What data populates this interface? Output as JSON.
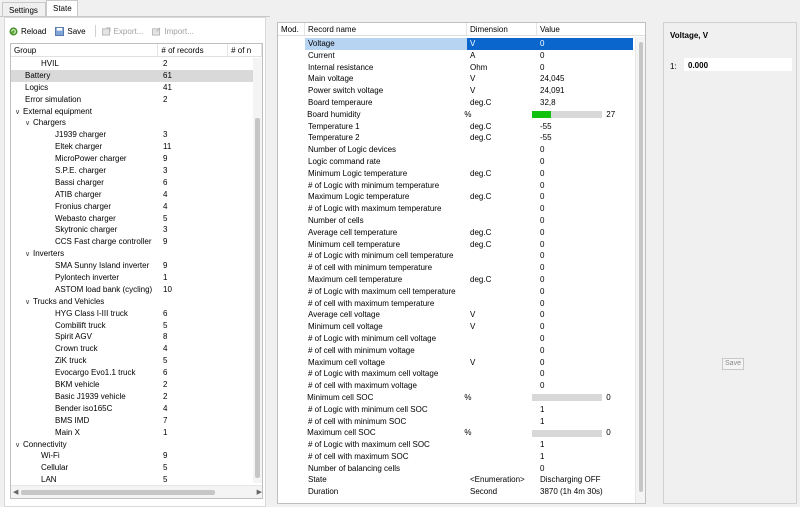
{
  "tabs": [
    {
      "label": "Settings",
      "active": false
    },
    {
      "label": "State",
      "active": true
    }
  ],
  "toolbar": {
    "reload": "Reload",
    "save": "Save",
    "export": "Export...",
    "import": "Import..."
  },
  "tree": {
    "columns": [
      "Group",
      "# of records",
      "# of n"
    ],
    "rows": [
      {
        "name": "HVIL",
        "count": "2",
        "level": 2,
        "arrow": ""
      },
      {
        "name": "Battery",
        "count": "61",
        "level": 1,
        "arrow": "",
        "selected": true
      },
      {
        "name": "Logics",
        "count": "41",
        "level": 1,
        "arrow": ""
      },
      {
        "name": "Error simulation",
        "count": "2",
        "level": 1,
        "arrow": ""
      },
      {
        "name": "External equipment",
        "count": "",
        "level": 0,
        "arrow": "v"
      },
      {
        "name": "Chargers",
        "count": "",
        "level": 1,
        "arrow": "v"
      },
      {
        "name": "J1939 charger",
        "count": "3",
        "level": 3,
        "arrow": ""
      },
      {
        "name": "Eltek charger",
        "count": "11",
        "level": 3,
        "arrow": ""
      },
      {
        "name": "MicroPower charger",
        "count": "9",
        "level": 3,
        "arrow": ""
      },
      {
        "name": "S.P.E. charger",
        "count": "3",
        "level": 3,
        "arrow": ""
      },
      {
        "name": "Bassi charger",
        "count": "6",
        "level": 3,
        "arrow": ""
      },
      {
        "name": "ATIB charger",
        "count": "4",
        "level": 3,
        "arrow": ""
      },
      {
        "name": "Fronius charger",
        "count": "4",
        "level": 3,
        "arrow": ""
      },
      {
        "name": "Webasto charger",
        "count": "5",
        "level": 3,
        "arrow": ""
      },
      {
        "name": "Skytronic charger",
        "count": "3",
        "level": 3,
        "arrow": ""
      },
      {
        "name": "CCS Fast charge controller",
        "count": "9",
        "level": 3,
        "arrow": ""
      },
      {
        "name": "Inverters",
        "count": "",
        "level": 1,
        "arrow": "v"
      },
      {
        "name": "SMA Sunny Island inverter",
        "count": "9",
        "level": 3,
        "arrow": ""
      },
      {
        "name": "Pylontech inverter",
        "count": "1",
        "level": 3,
        "arrow": ""
      },
      {
        "name": "ASTOM load bank (cycling)",
        "count": "10",
        "level": 3,
        "arrow": ""
      },
      {
        "name": "Trucks and Vehicles",
        "count": "",
        "level": 1,
        "arrow": "v"
      },
      {
        "name": "HYG Class I-III truck",
        "count": "6",
        "level": 3,
        "arrow": ""
      },
      {
        "name": "Combilift truck",
        "count": "5",
        "level": 3,
        "arrow": ""
      },
      {
        "name": "Spirit AGV",
        "count": "8",
        "level": 3,
        "arrow": ""
      },
      {
        "name": "Crown truck",
        "count": "4",
        "level": 3,
        "arrow": ""
      },
      {
        "name": "ZiK truck",
        "count": "5",
        "level": 3,
        "arrow": ""
      },
      {
        "name": "Evocargo Evo1.1 truck",
        "count": "6",
        "level": 3,
        "arrow": ""
      },
      {
        "name": "BKM vehicle",
        "count": "2",
        "level": 3,
        "arrow": ""
      },
      {
        "name": "Basic J1939 vehicle",
        "count": "2",
        "level": 3,
        "arrow": ""
      },
      {
        "name": "Bender iso165C",
        "count": "4",
        "level": 3,
        "arrow": ""
      },
      {
        "name": "BMS IMD",
        "count": "7",
        "level": 3,
        "arrow": ""
      },
      {
        "name": "Main X",
        "count": "1",
        "level": 3,
        "arrow": ""
      },
      {
        "name": "Connectivity",
        "count": "",
        "level": 0,
        "arrow": "v"
      },
      {
        "name": "Wi-Fi",
        "count": "9",
        "level": 2,
        "arrow": ""
      },
      {
        "name": "Cellular",
        "count": "5",
        "level": 2,
        "arrow": ""
      },
      {
        "name": "LAN",
        "count": "5",
        "level": 2,
        "arrow": ""
      }
    ]
  },
  "records": {
    "columns": [
      "Mod.",
      "Record name",
      "Dimension",
      "Value"
    ],
    "rows": [
      {
        "name": "Voltage",
        "dim": "V",
        "val": "0",
        "selected": true
      },
      {
        "name": "Current",
        "dim": "A",
        "val": "0"
      },
      {
        "name": "Internal resistance",
        "dim": "Ohm",
        "val": "0"
      },
      {
        "name": "Main voltage",
        "dim": "V",
        "val": "24,045"
      },
      {
        "name": "Power switch voltage",
        "dim": "V",
        "val": "24,091"
      },
      {
        "name": "Board temperaure",
        "dim": "deg.C",
        "val": "32,8"
      },
      {
        "name": "Board humidity",
        "dim": "%",
        "val": "27",
        "bar": 0.27
      },
      {
        "name": "Temperature 1",
        "dim": "deg.C",
        "val": "-55"
      },
      {
        "name": "Temperature 2",
        "dim": "deg.C",
        "val": "-55"
      },
      {
        "name": "Number of Logic devices",
        "dim": "",
        "val": "0"
      },
      {
        "name": "Logic command rate",
        "dim": "",
        "val": "0"
      },
      {
        "name": "Minimum Logic temperature",
        "dim": "deg.C",
        "val": "0"
      },
      {
        "name": "# of Logic with minimum temperature",
        "dim": "",
        "val": "0"
      },
      {
        "name": "Maximum Logic temperature",
        "dim": "deg.C",
        "val": "0"
      },
      {
        "name": "# of Logic with maximum temperature",
        "dim": "",
        "val": "0"
      },
      {
        "name": "Number of cells",
        "dim": "",
        "val": "0"
      },
      {
        "name": "Average cell temperature",
        "dim": "deg.C",
        "val": "0"
      },
      {
        "name": "Minimum cell temperature",
        "dim": "deg.C",
        "val": "0"
      },
      {
        "name": "# of Logic with minimum cell temperature",
        "dim": "",
        "val": "0"
      },
      {
        "name": "# of cell with minimum temperature",
        "dim": "",
        "val": "0"
      },
      {
        "name": "Maximum cell temperature",
        "dim": "deg.C",
        "val": "0"
      },
      {
        "name": "# of Logic with maximum cell temperature",
        "dim": "",
        "val": "0"
      },
      {
        "name": "# of cell with maximum temperature",
        "dim": "",
        "val": "0"
      },
      {
        "name": "Average cell voltage",
        "dim": "V",
        "val": "0"
      },
      {
        "name": "Minimum cell voltage",
        "dim": "V",
        "val": "0"
      },
      {
        "name": "# of Logic with minimum cell voltage",
        "dim": "",
        "val": "0"
      },
      {
        "name": "# of cell with minimum voltage",
        "dim": "",
        "val": "0"
      },
      {
        "name": "Maximum cell voltage",
        "dim": "V",
        "val": "0"
      },
      {
        "name": "# of Logic with maximum cell voltage",
        "dim": "",
        "val": "0"
      },
      {
        "name": "# of cell with maximum voltage",
        "dim": "",
        "val": "0"
      },
      {
        "name": "Minimum cell SOC",
        "dim": "%",
        "val": "0",
        "bar": 0
      },
      {
        "name": "# of Logic with minimum cell SOC",
        "dim": "",
        "val": "1"
      },
      {
        "name": "# of cell with minimum SOC",
        "dim": "",
        "val": "1"
      },
      {
        "name": "Maximum cell SOC",
        "dim": "%",
        "val": "0",
        "bar": 0
      },
      {
        "name": "# of Logic with maximum cell SOC",
        "dim": "",
        "val": "1"
      },
      {
        "name": "# of cell with maximum SOC",
        "dim": "",
        "val": "1"
      },
      {
        "name": "Number of balancing cells",
        "dim": "",
        "val": "0"
      },
      {
        "name": "State",
        "dim": "<Enumeration>",
        "val": "Discharging OFF"
      },
      {
        "name": "Duration",
        "dim": "Second",
        "val": "3870 (1h 4m 30s)"
      }
    ]
  },
  "editor": {
    "title": "Voltage, V",
    "index_label": "1:",
    "value": "0.000",
    "save_label": "Save"
  },
  "colors": {
    "selection": "#0a66cc",
    "bar_fill": "#0fc20f"
  }
}
